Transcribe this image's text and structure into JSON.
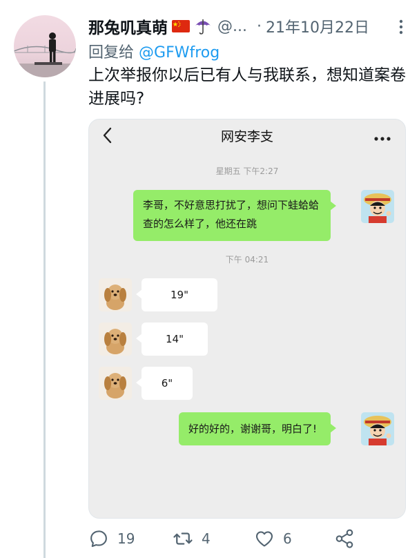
{
  "tweet": {
    "display_name": "那兔叽真萌",
    "handle": "@...",
    "separator": "·",
    "date": "21年10月22日",
    "reply_prefix": "回复给",
    "reply_to": "@GFWfrog",
    "text": "上次举报你以后已有人与我联系，想知道案卷进展吗?"
  },
  "chat": {
    "title": "网安李支",
    "timestamp1": "星期五 下午2:27",
    "msg_outgoing_1": "李哥，不好意思打扰了，想问下蛙蛤蛤查的怎么样了，他还在跳",
    "timestamp2": "下午 04:21",
    "voice_1": "19\"",
    "voice_2": "14\"",
    "voice_3": "6\"",
    "msg_outgoing_2": "好的好的，谢谢哥，明白了!"
  },
  "actions": {
    "reply_count": "19",
    "retweet_count": "4",
    "like_count": "6"
  },
  "colors": {
    "link_blue": "#1d9bf0",
    "muted_gray": "#536471",
    "wechat_green": "#95ec69",
    "chat_background": "#ededed"
  },
  "icons": [
    "china-flag-icon",
    "umbrella-icon",
    "more-icon",
    "back-icon",
    "more-dots-icon",
    "reply-icon",
    "retweet-icon",
    "like-icon",
    "share-icon"
  ]
}
